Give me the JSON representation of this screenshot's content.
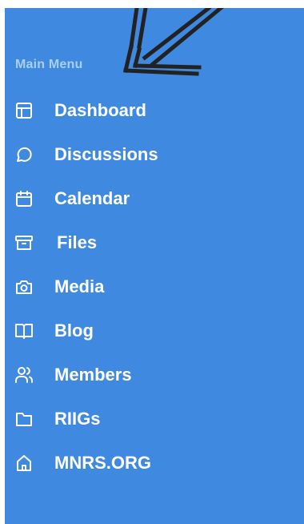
{
  "sidebar": {
    "section_label": "Main Menu",
    "items": [
      {
        "label": "Dashboard",
        "icon": "layout-icon"
      },
      {
        "label": "Discussions",
        "icon": "chat-bubble-icon"
      },
      {
        "label": "Calendar",
        "icon": "calendar-icon"
      },
      {
        "label": "Files",
        "icon": "archive-box-icon"
      },
      {
        "label": "Media",
        "icon": "camera-icon"
      },
      {
        "label": "Blog",
        "icon": "open-book-icon"
      },
      {
        "label": "Members",
        "icon": "users-icon"
      },
      {
        "label": "RIIGs",
        "icon": "folder-icon"
      },
      {
        "label": "MNRS.ORG",
        "icon": "home-icon"
      }
    ]
  },
  "colors": {
    "sidebar_bg": "#3f8ae0",
    "section_label": "#a9cdf3",
    "item_text": "#ffffff",
    "annotation_arrow": "#222222"
  }
}
